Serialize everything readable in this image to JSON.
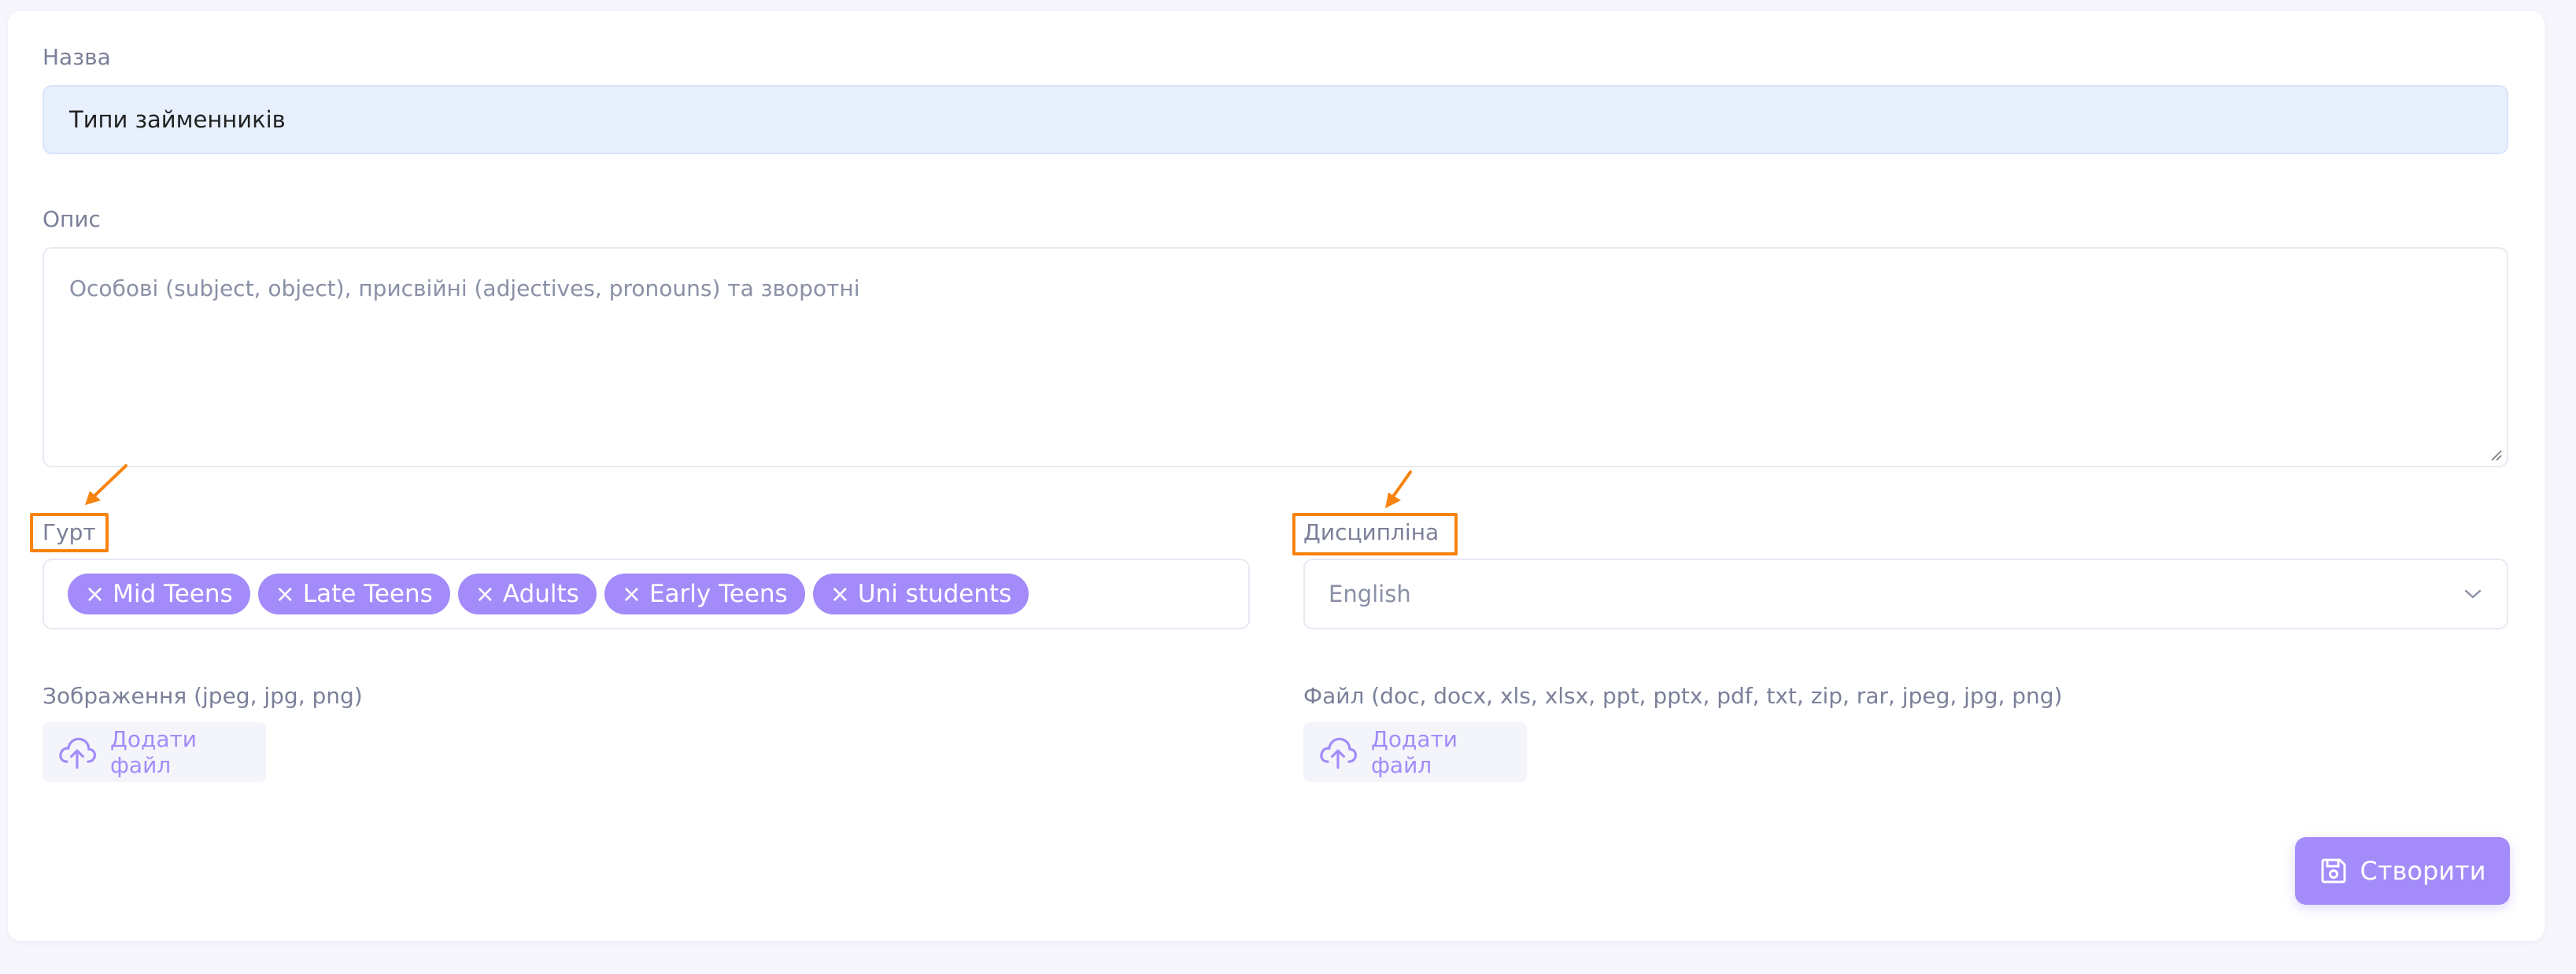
{
  "form": {
    "name_label": "Назва",
    "name_value": "Типи займенників",
    "description_label": "Опис",
    "description_placeholder": "Особові (subject, object), присвійні (adjectives, pronouns) та зворотні",
    "group_label": "Гурт",
    "group_tags": [
      "Mid Teens",
      "Late Teens",
      "Adults",
      "Early Teens",
      "Uni students"
    ],
    "tag_remove_symbol": "×",
    "discipline_label": "Дисципліна",
    "discipline_value": "English",
    "image_label": "Зображення (jpeg, jpg, png)",
    "image_upload_label": "Додати файл",
    "file_label": "Файл (doc, docx, xls, xlsx, ppt, pptx, pdf, txt, zip, rar, jpeg, jpg, png)",
    "file_upload_label": "Додати файл",
    "submit_label": "Створити"
  },
  "colors": {
    "accent": "#a38bfa",
    "highlight": "#f7830f",
    "name_input_bg": "#e8f0fe",
    "label_text": "#7b8099"
  },
  "icons": {
    "upload": "cloud-upload-icon",
    "save": "floppy-disk-icon",
    "dropdown": "chevron-down-icon"
  }
}
